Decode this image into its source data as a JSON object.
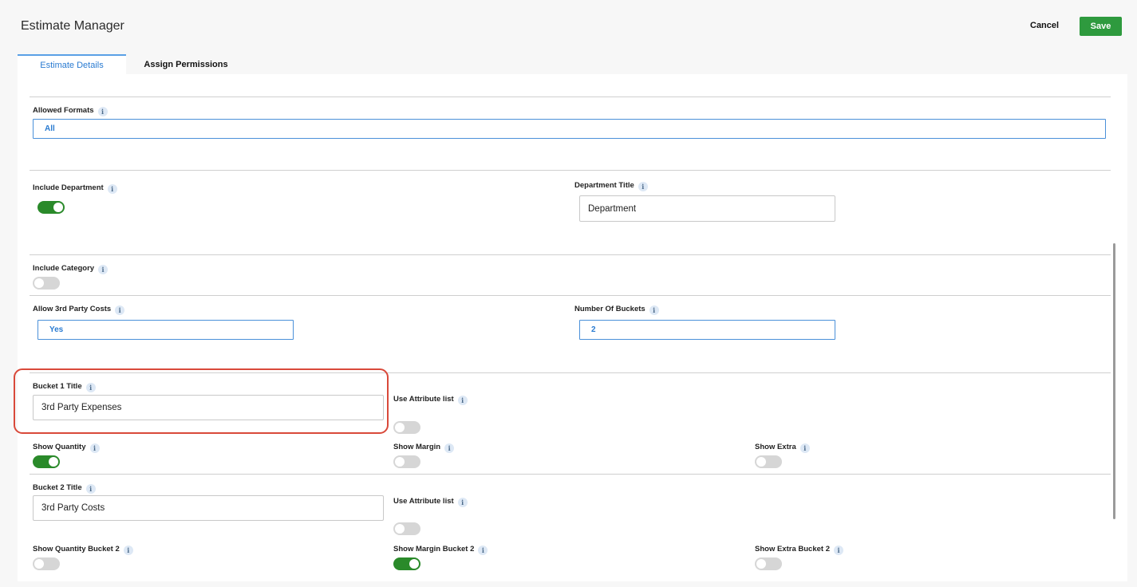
{
  "header": {
    "title": "Estimate Manager",
    "cancel_label": "Cancel",
    "save_label": "Save"
  },
  "tabs": [
    {
      "label": "Estimate Details"
    },
    {
      "label": "Assign Permissions"
    }
  ],
  "colors": {
    "save": "#2e9a3e",
    "toggle_on": "#2a8a2a",
    "highlight": "#d9493a",
    "accent": "#2a7bd1"
  },
  "info_icon": "i",
  "fields": {
    "allowed_formats": {
      "label": "Allowed Formats",
      "value": "All"
    },
    "include_department": {
      "label": "Include Department",
      "on": true
    },
    "department_title": {
      "label": "Department Title",
      "value": "Department"
    },
    "include_category": {
      "label": "Include Category",
      "on": false
    },
    "allow_3rd_party": {
      "label": "Allow 3rd Party Costs",
      "value": "Yes"
    },
    "number_of_buckets": {
      "label": "Number Of Buckets",
      "value": "2"
    },
    "bucket1_title": {
      "label": "Bucket 1 Title",
      "value": "3rd Party Expenses"
    },
    "use_attr_1": {
      "label": "Use Attribute list",
      "on": false
    },
    "show_quantity": {
      "label": "Show Quantity",
      "on": true
    },
    "show_margin": {
      "label": "Show Margin",
      "on": false
    },
    "show_extra": {
      "label": "Show Extra",
      "on": false
    },
    "bucket2_title": {
      "label": "Bucket 2 Title",
      "value": "3rd Party Costs"
    },
    "use_attr_2": {
      "label": "Use Attribute list",
      "on": false
    },
    "show_quantity_b2": {
      "label": "Show Quantity Bucket 2",
      "on": false
    },
    "show_margin_b2": {
      "label": "Show Margin Bucket 2",
      "on": true
    },
    "show_extra_b2": {
      "label": "Show Extra Bucket 2",
      "on": false
    }
  }
}
